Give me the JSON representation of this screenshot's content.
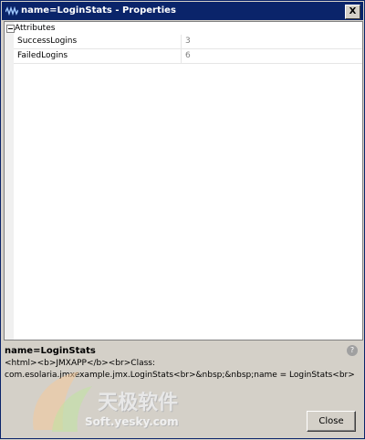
{
  "window": {
    "title": "name=LoginStats - Properties",
    "close_glyph": "X"
  },
  "grid": {
    "group_label": "Attributes",
    "rows": [
      {
        "name": "SuccessLogins",
        "value": "3"
      },
      {
        "name": "FailedLogins",
        "value": "6"
      }
    ]
  },
  "description": {
    "name": "name=LoginStats",
    "text": "<html><b>JMXAPP</b><br>Class: com.esolaria.jmxexample.jmx.LoginStats<br>&nbsp;&nbsp;name = LoginStats<br>",
    "help_glyph": "?"
  },
  "watermark": {
    "title": "天极软件",
    "url": "Soft.yesky.com"
  },
  "buttons": {
    "close_label": "Close"
  },
  "colors": {
    "titlebar": "#0a246a",
    "panel": "#d4d0c8",
    "value_text": "#808080"
  },
  "icons": {
    "app": "wave-icon",
    "collapse": "minus-box-icon",
    "help": "help-icon"
  }
}
